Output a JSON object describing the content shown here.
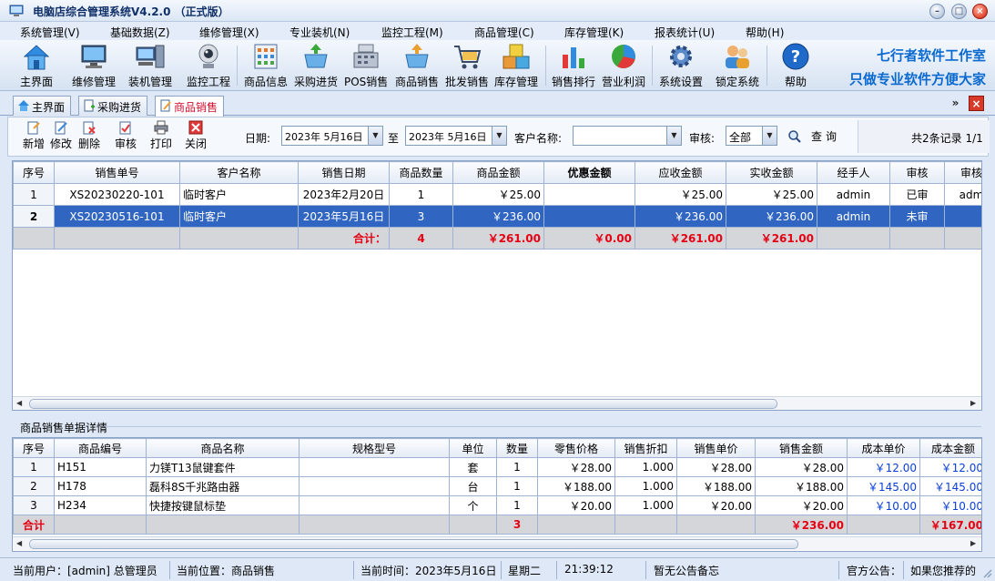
{
  "window": {
    "title": "电脑店综合管理系统V4.2.0 （正式版）"
  },
  "menu": [
    "系统管理(V)",
    "基础数据(Z)",
    "维修管理(X)",
    "专业装机(N)",
    "监控工程(M)",
    "商品管理(C)",
    "库存管理(K)",
    "报表统计(U)",
    "帮助(H)"
  ],
  "toolbar": {
    "buttons": [
      "主界面",
      "维修管理",
      "装机管理",
      "监控工程",
      "商品信息",
      "采购进货",
      "POS销售",
      "商品销售",
      "批发销售",
      "库存管理",
      "销售排行",
      "营业利润",
      "系统设置",
      "锁定系统",
      "帮助"
    ],
    "brand_line1": "七行者软件工作室",
    "brand_line2": "只做专业软件方便大家"
  },
  "tabs": [
    "主界面",
    "采购进货",
    "商品销售"
  ],
  "subtoolbar": {
    "buttons": [
      "新增",
      "修改",
      "删除",
      "审核",
      "打印",
      "关闭"
    ],
    "date_label": "日期:",
    "date_from": "2023年 5月16日",
    "to_label": "至",
    "date_to": "2023年 5月16日",
    "customer_label": "客户名称:",
    "customer_value": "",
    "audit_label": "审核:",
    "audit_value": "全部",
    "query_label": "查询",
    "record_info": "共2条记录 1/1"
  },
  "sales_grid": {
    "columns": [
      "序号",
      "销售单号",
      "客户名称",
      "销售日期",
      "商品数量",
      "商品金额",
      "优惠金额",
      "应收金额",
      "实收金额",
      "经手人",
      "审核",
      "审核"
    ],
    "rows": [
      [
        "1",
        "XS20230220-101",
        "临时客户",
        "2023年2月20日",
        "1",
        "￥25.00",
        "",
        "￥25.00",
        "￥25.00",
        "admin",
        "已审",
        "adm"
      ],
      [
        "2",
        "XS20230516-101",
        "临时客户",
        "2023年5月16日",
        "3",
        "￥236.00",
        "",
        "￥236.00",
        "￥236.00",
        "admin",
        "未审",
        ""
      ]
    ],
    "total_label": "合计：",
    "totals": [
      "4",
      "￥261.00",
      "￥0.00",
      "￥261.00",
      "￥261.00"
    ]
  },
  "detail_label": "商品销售单据详情",
  "detail_grid": {
    "columns": [
      "序号",
      "商品编号",
      "商品名称",
      "规格型号",
      "单位",
      "数量",
      "零售价格",
      "销售折扣",
      "销售单价",
      "销售金额",
      "成本单价",
      "成本金额"
    ],
    "rows": [
      [
        "1",
        "H151",
        "力镁T13鼠键套件",
        "",
        "套",
        "1",
        "￥28.00",
        "1.000",
        "￥28.00",
        "￥28.00",
        "￥12.00",
        "￥12.00"
      ],
      [
        "2",
        "H178",
        "磊科8S千兆路由器",
        "",
        "台",
        "1",
        "￥188.00",
        "1.000",
        "￥188.00",
        "￥188.00",
        "￥145.00",
        "￥145.00"
      ],
      [
        "3",
        "H234",
        "快捷按键鼠标垫",
        "",
        "个",
        "1",
        "￥20.00",
        "1.000",
        "￥20.00",
        "￥20.00",
        "￥10.00",
        "￥10.00"
      ]
    ],
    "total_label": "合计",
    "totals": [
      "3",
      "￥236.00",
      "￥167.00"
    ]
  },
  "statusbar": {
    "user": "当前用户：[admin] 总管理员",
    "location": "当前位置：商品销售",
    "time_label": "当前时间：2023年5月16日",
    "weekday": "星期二",
    "clock": "21:39:12",
    "notice": "暂无公告备忘",
    "announce_label": "官方公告：",
    "announce_text": "如果您推荐的"
  }
}
